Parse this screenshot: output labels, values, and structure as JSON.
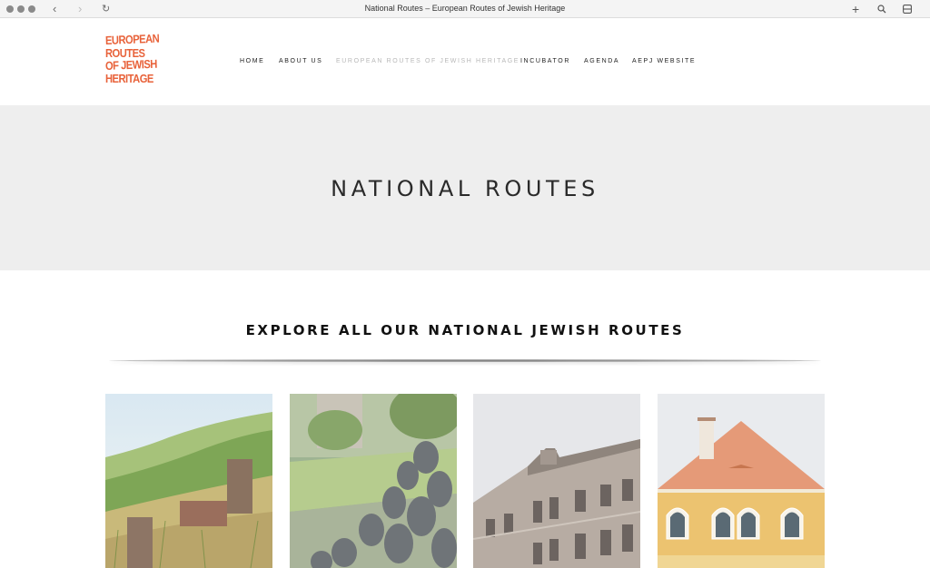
{
  "browser": {
    "tab_title": "National Routes – European Routes of Jewish Heritage"
  },
  "logo": {
    "lines": [
      "EUROPEAN",
      "ROUTES",
      "OF JEWISH",
      "HERITAGE"
    ],
    "color": "#e8623a"
  },
  "nav": {
    "items": [
      {
        "label": "HOME"
      },
      {
        "label": "ABOUT US"
      },
      {
        "label": "EUROPEAN ROUTES OF JEWISH HERITAGE"
      },
      {
        "label": "INCUBATOR"
      },
      {
        "label": "AGENDA"
      },
      {
        "label": "AEPJ WEBSITE"
      }
    ],
    "active_index": 2
  },
  "hero": {
    "title": "NATIONAL ROUTES"
  },
  "section": {
    "title": "EXPLORE ALL OUR NATIONAL JEWISH ROUTES"
  },
  "cards": [
    {
      "image": "hillside-ruins-photo"
    },
    {
      "image": "memorial-sculpture-photo"
    },
    {
      "image": "historic-building-photo"
    },
    {
      "image": "orange-synagogue-photo"
    }
  ],
  "colors": {
    "accent": "#e8623a",
    "hero_bg": "#eeeeee",
    "nav_active": "#b8b8b8"
  }
}
